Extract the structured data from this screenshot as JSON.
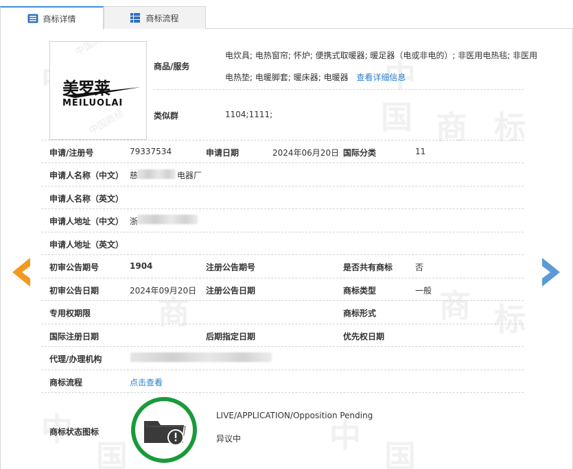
{
  "tabs": [
    {
      "label": "商标详情",
      "active": true,
      "icon": "list-icon"
    },
    {
      "label": "商标流程",
      "active": false,
      "icon": "grid-icon"
    }
  ],
  "logo": {
    "chinese": "美罗莱",
    "latin": "MEILUOLAI"
  },
  "goods": {
    "label": "商品/服务",
    "line1": "电炊具; 电热窗帘; 怀炉; 便携式取暖器; 暖足器（电或非电的）; 非医用电热毯; 非医用",
    "line2": "电热垫; 电暖脚套; 暖床器; 电暖器",
    "more_link": "查看详细信息"
  },
  "similar_group": {
    "label": "类似群",
    "value": "1104;1111;"
  },
  "fields": {
    "reg_no_label": "申请/注册号",
    "reg_no": "79337534",
    "app_date_label": "申请日期",
    "app_date": "2024年06月20日",
    "intl_class_label": "国际分类",
    "intl_class": "11",
    "applicant_cn_label": "申请人名称（中文）",
    "applicant_cn_prefix": "慈",
    "applicant_cn_suffix": "电器厂",
    "applicant_en_label": "申请人名称（英文）",
    "address_cn_label": "申请人地址（中文）",
    "address_cn_prefix": "浙",
    "address_en_label": "申请人地址（英文）",
    "prelim_no_label": "初审公告期号",
    "prelim_no": "1904",
    "reg_pub_no_label": "注册公告期号",
    "shared_label": "是否共有商标",
    "shared": "否",
    "prelim_date_label": "初审公告日期",
    "prelim_date": "2024年09月20日",
    "reg_pub_date_label": "注册公告日期",
    "type_label": "商标类型",
    "type": "一般",
    "exclusive_label": "专用权期限",
    "form_label": "商标形式",
    "intl_reg_label": "国际注册日期",
    "later_label": "后期指定日期",
    "priority_label": "优先权日期",
    "agent_label": "代理/办理机构",
    "flow_label": "商标流程",
    "flow_link": "点击查看",
    "status_label": "商标状态图标",
    "status_en": "LIVE/APPLICATION/Opposition Pending",
    "status_cn": "异议中"
  },
  "watermark": [
    "中",
    "国",
    "商",
    "标"
  ],
  "colors": {
    "accent": "#2a7fd0",
    "arrow_left": "#f39a1e",
    "arrow_right": "#5b9bd5",
    "status_ring": "#1a9a3b"
  }
}
